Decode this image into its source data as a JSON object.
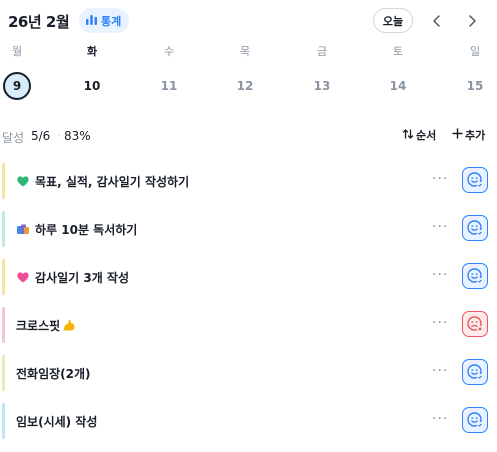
{
  "header": {
    "month_title": "26년 2월",
    "stats_label": "통계",
    "today_label": "오늘",
    "accent": "#3182f6"
  },
  "week": {
    "days": [
      {
        "dow": "월",
        "date": "9",
        "selected": true
      },
      {
        "dow": "화",
        "date": "10"
      },
      {
        "dow": "수",
        "date": "11"
      },
      {
        "dow": "목",
        "date": "12"
      },
      {
        "dow": "금",
        "date": "13"
      },
      {
        "dow": "토",
        "date": "14"
      },
      {
        "dow": "일",
        "date": "15"
      }
    ]
  },
  "summary": {
    "label": "달성",
    "count": "5/6",
    "separator": "·",
    "percent": "83%",
    "order_label": "순서",
    "add_label": "추가"
  },
  "tasks": [
    {
      "title": "목표, 실적, 감사일기 작성하기",
      "emoji": "green-heart",
      "bar_color": "#f7e3a1",
      "status": "done"
    },
    {
      "title": "하루 10분 독서하기",
      "emoji": "books",
      "bar_color": "#bfe9e6",
      "status": "done"
    },
    {
      "title": "감사일기 3개 작성",
      "emoji": "pink-heart",
      "bar_color": "#f7e3a1",
      "status": "done"
    },
    {
      "title": "크로스핏",
      "emoji": "flexed-biceps",
      "bar_color": "#f6c6cf",
      "status": "failed"
    },
    {
      "title": "전화임장(2개)",
      "emoji": "",
      "bar_color": "#e6edb9",
      "status": "done"
    },
    {
      "title": "임보(시세) 작성",
      "emoji": "",
      "bar_color": "#bfe4f4",
      "status": "done"
    }
  ]
}
